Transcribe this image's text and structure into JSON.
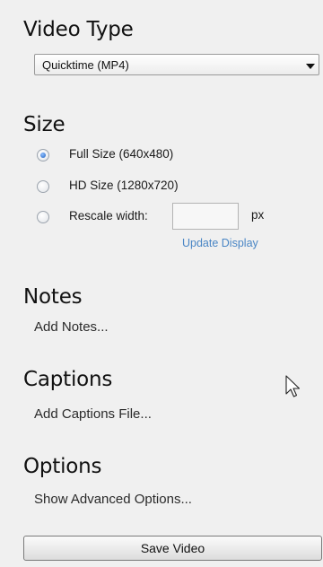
{
  "video_type": {
    "heading": "Video Type",
    "selected": "Quicktime (MP4)"
  },
  "size": {
    "heading": "Size",
    "options": [
      {
        "label": "Full Size (640x480)",
        "selected": true
      },
      {
        "label": "HD Size (1280x720)",
        "selected": false
      },
      {
        "label": "Rescale width:",
        "selected": false
      }
    ],
    "rescale_value": "",
    "unit": "px",
    "update_link": "Update Display"
  },
  "notes": {
    "heading": "Notes",
    "link": "Add Notes..."
  },
  "captions": {
    "heading": "Captions",
    "link": "Add Captions File..."
  },
  "options": {
    "heading": "Options",
    "link": "Show Advanced Options..."
  },
  "save_button": "Save Video",
  "colors": {
    "background": "#f0f0f0",
    "link": "#4a86c5",
    "radio_selected": "#1f5fbf"
  }
}
